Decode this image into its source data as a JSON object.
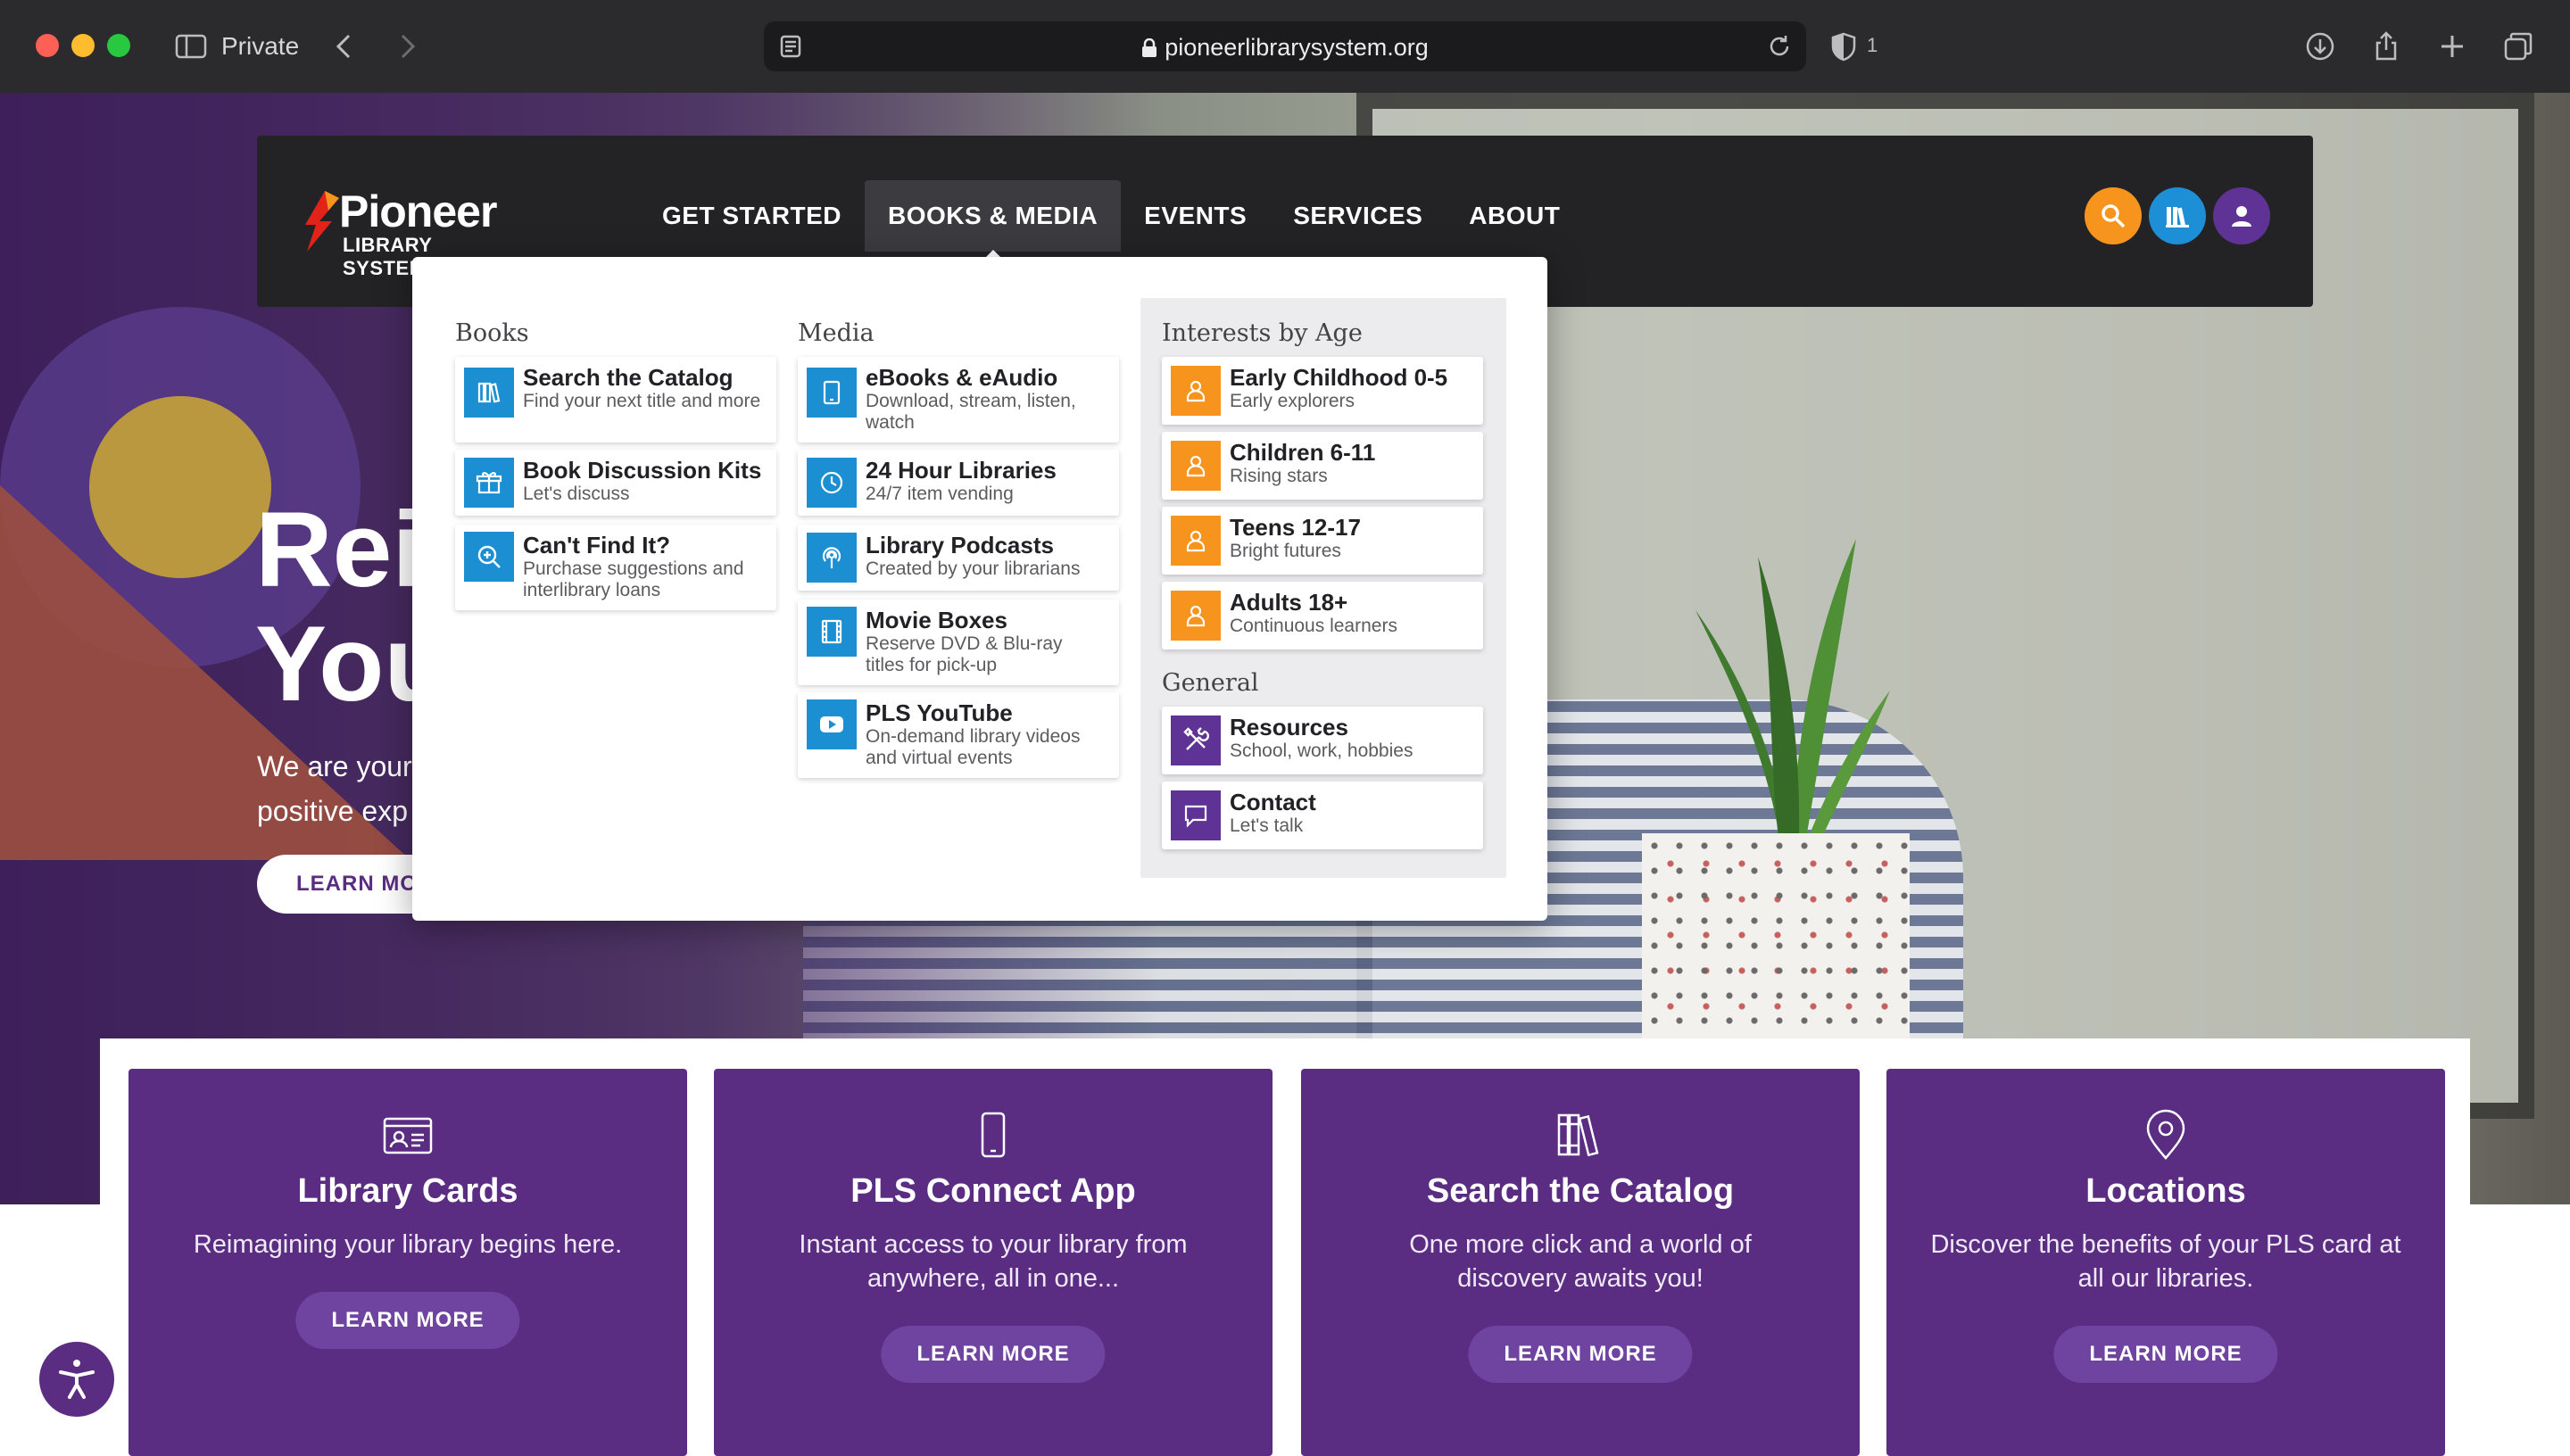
{
  "browser": {
    "private_label": "Private",
    "url": "pioneerlibrarysystem.org",
    "shield_count": "1"
  },
  "header": {
    "logo_name": "Pioneer",
    "logo_sub": "LIBRARY SYSTEM",
    "nav": [
      "GET STARTED",
      "BOOKS & MEDIA",
      "EVENTS",
      "SERVICES",
      "ABOUT"
    ],
    "active_nav": "BOOKS & MEDIA"
  },
  "mega_menu": {
    "books": {
      "title": "Books",
      "items": [
        {
          "title": "Search the Catalog",
          "desc": "Find your next title and more",
          "icon": "books-icon"
        },
        {
          "title": "Book Discussion Kits",
          "desc": "Let's discuss",
          "icon": "gift-box-icon"
        },
        {
          "title": "Can't Find It?",
          "desc": "Purchase suggestions and interlibrary loans",
          "icon": "zoom-in-icon"
        }
      ]
    },
    "media": {
      "title": "Media",
      "items": [
        {
          "title": "eBooks & eAudio",
          "desc": "Download, stream, listen, watch",
          "icon": "tablet-icon"
        },
        {
          "title": "24 Hour Libraries",
          "desc": "24/7 item vending",
          "icon": "clock-icon"
        },
        {
          "title": "Library Podcasts",
          "desc": "Created by your librarians",
          "icon": "podcast-icon"
        },
        {
          "title": "Movie Boxes",
          "desc": "Reserve DVD & Blu-ray titles for pick-up",
          "icon": "film-icon"
        },
        {
          "title": "PLS YouTube",
          "desc": "On-demand library videos and virtual events",
          "icon": "youtube-icon"
        }
      ]
    },
    "ages": {
      "title": "Interests by Age",
      "items": [
        {
          "title": "Early Childhood 0-5",
          "desc": "Early explorers",
          "icon": "person-icon"
        },
        {
          "title": "Children 6-11",
          "desc": "Rising stars",
          "icon": "person-icon"
        },
        {
          "title": "Teens 12-17",
          "desc": "Bright futures",
          "icon": "person-icon"
        },
        {
          "title": "Adults 18+",
          "desc": "Continuous learners",
          "icon": "person-icon"
        }
      ]
    },
    "general": {
      "title": "General",
      "items": [
        {
          "title": "Resources",
          "desc": "School, work, hobbies",
          "icon": "tools-icon"
        },
        {
          "title": "Contact",
          "desc": "Let's talk",
          "icon": "chat-icon"
        }
      ]
    }
  },
  "hero": {
    "title_line1": "Rei",
    "title_line2": "You",
    "text_line1": "We are your",
    "text_line2": "positive exp",
    "button": "LEARN MOR"
  },
  "promos": [
    {
      "title": "Library Cards",
      "desc": "Reimagining your library begins here.",
      "button": "LEARN MORE",
      "icon": "id-card-icon"
    },
    {
      "title": "PLS Connect App",
      "desc": "Instant access to your library from anywhere, all in one...",
      "button": "LEARN MORE",
      "icon": "phone-icon"
    },
    {
      "title": "Search the Catalog",
      "desc": "One more click and a world of discovery awaits you!",
      "button": "LEARN MORE",
      "icon": "books-icon"
    },
    {
      "title": "Locations",
      "desc": "Discover the benefits of your PLS card at all our libraries.",
      "button": "LEARN MORE",
      "icon": "map-pin-icon"
    }
  ],
  "colors": {
    "brand_purple": "#5a2d82",
    "accent_orange": "#f7941d",
    "accent_blue": "#1b8fd2",
    "header_dark": "#232325"
  }
}
